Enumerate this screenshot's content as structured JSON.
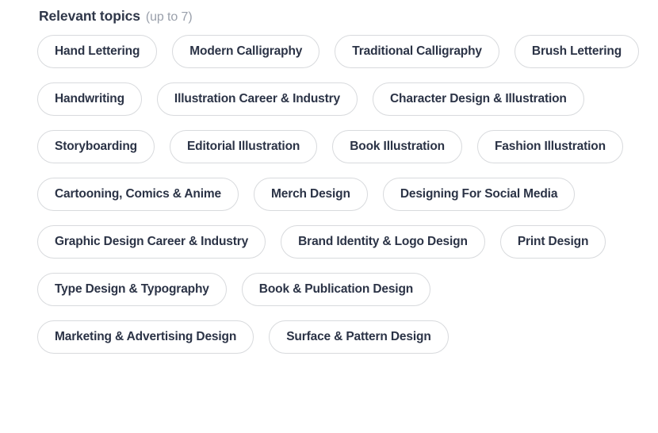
{
  "section": {
    "title": "Relevant topics",
    "hint": "(up to 7)",
    "max_selectable": 7
  },
  "topics": [
    {
      "label": "Hand Lettering",
      "row": 1
    },
    {
      "label": "Modern Calligraphy",
      "row": 1
    },
    {
      "label": "Traditional Calligraphy",
      "row": 1
    },
    {
      "label": "Brush Lettering",
      "row": 2
    },
    {
      "label": "Handwriting",
      "row": 2
    },
    {
      "label": "Illustration Career & Industry",
      "row": 2
    },
    {
      "label": "Character Design & Illustration",
      "row": 3
    },
    {
      "label": "Storyboarding",
      "row": 3
    },
    {
      "label": "Editorial Illustration",
      "row": 3
    },
    {
      "label": "Book Illustration",
      "row": 4
    },
    {
      "label": "Fashion Illustration",
      "row": 4
    },
    {
      "label": "Cartooning, Comics & Anime",
      "row": 4
    },
    {
      "label": "Merch Design",
      "row": 5
    },
    {
      "label": "Designing For Social Media",
      "row": 5
    },
    {
      "label": "Graphic Design Career & Industry",
      "row": 6
    },
    {
      "label": "Brand Identity & Logo Design",
      "row": 6
    },
    {
      "label": "Print Design",
      "row": 7
    },
    {
      "label": "Type Design & Typography",
      "row": 7
    },
    {
      "label": "Book & Publication Design",
      "row": 7
    },
    {
      "label": "Marketing & Advertising Design",
      "row": 8
    },
    {
      "label": "Surface & Pattern Design",
      "row": 8
    }
  ],
  "colors": {
    "background": "#ffffff",
    "pill_border": "#d8dadd",
    "pill_text": "#2b3346",
    "heading_text": "#2f3749",
    "hint_text": "#9aa0ab"
  }
}
